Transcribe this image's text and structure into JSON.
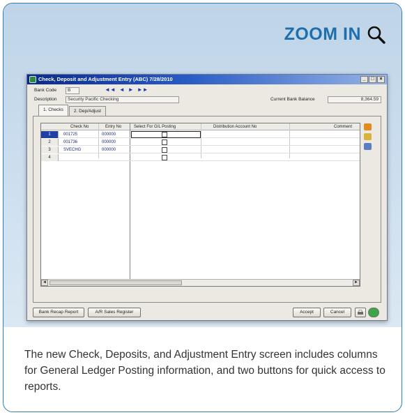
{
  "zoom": {
    "label": "ZOOM IN",
    "icon": "magnifier-icon"
  },
  "caption": "The new Check, Deposits, and Adjustment Entry screen includes columns for General Ledger Posting information, and two buttons for quick access to reports.",
  "window": {
    "title": "Check, Deposit and Adjustment Entry (ABC) 7/28/2010",
    "controls": [
      "_",
      "□",
      "×"
    ],
    "bank_code_label": "Bank Code",
    "bank_code_value": "B",
    "description_label": "Description",
    "description_value": "Security Pacific Checking",
    "balance_label": "Current Bank Balance",
    "balance_value": "8,364.59",
    "nav_arrows": [
      "◄◄",
      "◄",
      "►",
      "►►"
    ]
  },
  "tabs": [
    {
      "label": "1. Checks",
      "active": true
    },
    {
      "label": "2. Dep/Adjust",
      "active": false
    }
  ],
  "grid": {
    "columns": [
      "Check No",
      "Entry No",
      "Select For G/L Posting",
      "Distribution Account No",
      "Comment"
    ],
    "rows": [
      {
        "num": "1",
        "check_no": "001725",
        "entry_no": "000000",
        "selected": true
      },
      {
        "num": "2",
        "check_no": "001736",
        "entry_no": "000000",
        "selected": false
      },
      {
        "num": "3",
        "check_no": "SVECHG",
        "entry_no": "000000",
        "selected": false
      },
      {
        "num": "4",
        "check_no": "",
        "entry_no": "",
        "selected": false
      }
    ]
  },
  "buttons": {
    "bank_recap": "Bank Recap Report",
    "ar_ssr": "A/R Sales Register",
    "accept": "Accept",
    "cancel": "Cancel"
  },
  "colors": {
    "accent": "#1f6fae",
    "card_border": "#2d7dbb",
    "titlebar": "#0a2a8a"
  }
}
